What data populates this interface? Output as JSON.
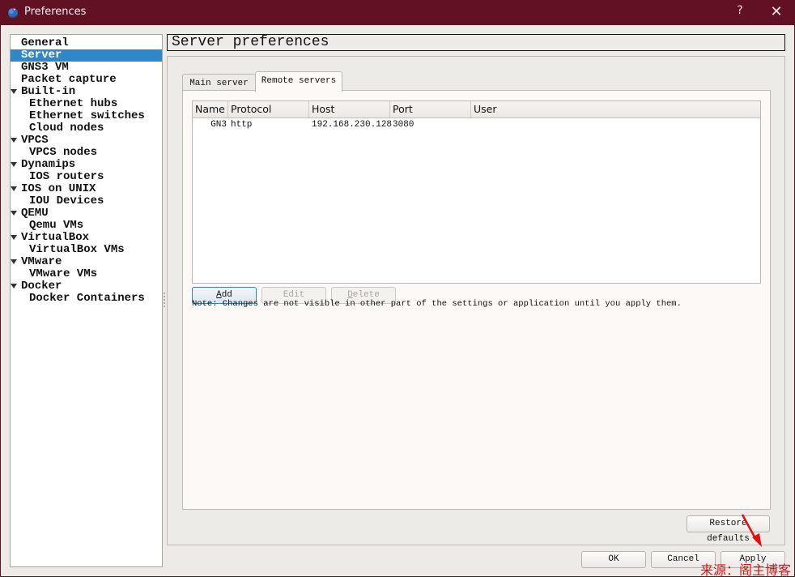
{
  "window": {
    "title": "Preferences",
    "help_label": "?",
    "close_label": "✕",
    "icon": "gns3-chameleon-icon"
  },
  "sidebar": {
    "items": [
      {
        "label": "General",
        "level": 0,
        "expandable": false,
        "selected": false
      },
      {
        "label": "Server",
        "level": 0,
        "expandable": false,
        "selected": true
      },
      {
        "label": "GNS3 VM",
        "level": 0,
        "expandable": false,
        "selected": false
      },
      {
        "label": "Packet capture",
        "level": 0,
        "expandable": false,
        "selected": false
      },
      {
        "label": "Built-in",
        "level": 0,
        "expandable": true,
        "selected": false
      },
      {
        "label": "Ethernet hubs",
        "level": 1,
        "expandable": false,
        "selected": false
      },
      {
        "label": "Ethernet switches",
        "level": 1,
        "expandable": false,
        "selected": false
      },
      {
        "label": "Cloud nodes",
        "level": 1,
        "expandable": false,
        "selected": false
      },
      {
        "label": "VPCS",
        "level": 0,
        "expandable": true,
        "selected": false
      },
      {
        "label": "VPCS nodes",
        "level": 1,
        "expandable": false,
        "selected": false
      },
      {
        "label": "Dynamips",
        "level": 0,
        "expandable": true,
        "selected": false
      },
      {
        "label": "IOS routers",
        "level": 1,
        "expandable": false,
        "selected": false
      },
      {
        "label": "IOS on UNIX",
        "level": 0,
        "expandable": true,
        "selected": false
      },
      {
        "label": "IOU Devices",
        "level": 1,
        "expandable": false,
        "selected": false
      },
      {
        "label": "QEMU",
        "level": 0,
        "expandable": true,
        "selected": false
      },
      {
        "label": "Qemu VMs",
        "level": 1,
        "expandable": false,
        "selected": false
      },
      {
        "label": "VirtualBox",
        "level": 0,
        "expandable": true,
        "selected": false
      },
      {
        "label": "VirtualBox VMs",
        "level": 1,
        "expandable": false,
        "selected": false
      },
      {
        "label": "VMware",
        "level": 0,
        "expandable": true,
        "selected": false
      },
      {
        "label": "VMware VMs",
        "level": 1,
        "expandable": false,
        "selected": false
      },
      {
        "label": "Docker",
        "level": 0,
        "expandable": true,
        "selected": false
      },
      {
        "label": "Docker Containers",
        "level": 1,
        "expandable": false,
        "selected": false
      }
    ]
  },
  "page": {
    "title": "Server preferences",
    "tabs": [
      {
        "label": "Main server",
        "active": false
      },
      {
        "label": "Remote servers",
        "active": true
      }
    ],
    "table": {
      "columns": [
        "Name",
        "Protocol",
        "Host",
        "Port",
        "User"
      ],
      "rows": [
        {
          "name": "GN3",
          "protocol": "http",
          "host": "192.168.230.128",
          "port": "3080",
          "user": ""
        }
      ]
    },
    "buttons": {
      "add": {
        "label_accel": "A",
        "label_rest": "dd",
        "enabled": true
      },
      "edit": {
        "label": "Edit",
        "enabled": false
      },
      "delete": {
        "label_accel": "D",
        "label_rest": "elete",
        "enabled": false
      }
    },
    "note": "Note: Changes are not visible in other part of the settings or application until you apply them.",
    "restore_defaults_label": "Restore defaults"
  },
  "footer": {
    "ok_label": "OK",
    "cancel_label": "Cancel",
    "apply_label": "Apply"
  },
  "annotation": {
    "watermark": "来源：阁主博客",
    "color": "#e01010"
  },
  "colors": {
    "titlebar": "#621123",
    "selection": "#2f86c8",
    "dialog_bg": "#edebe7"
  }
}
